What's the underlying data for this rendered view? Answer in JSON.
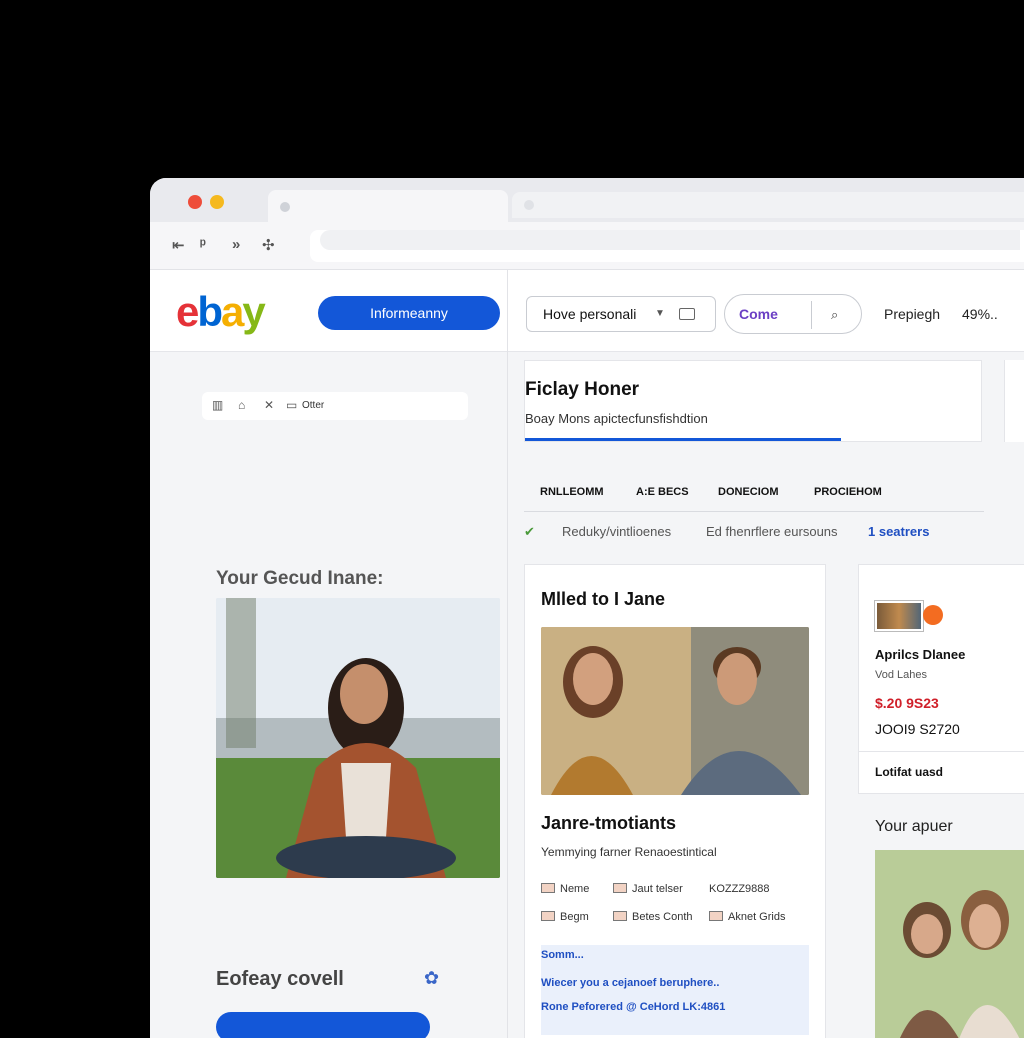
{
  "browser": {
    "nav_back": "⇤",
    "nav_p": "ᵖ",
    "nav_fwd": "»",
    "nav_ext": "✣"
  },
  "header": {
    "logo": {
      "e": "e",
      "b": "b",
      "a": "a",
      "y": "y"
    },
    "primary_button": "Informeanny",
    "select_label": "Hove personali",
    "pill_label": "Come",
    "right_text_1": "Prepiegh",
    "right_text_2": "49%.."
  },
  "left": {
    "search_text": "Otter",
    "section_title": "Your Gecud Inane:",
    "bottom_title": "Eofeay covell"
  },
  "main": {
    "panel_title": "Ficlay Honer",
    "panel_sub": "Boay Mons apictecfunsfishdtion",
    "tabs": [
      "RNLLEOMM",
      "A:E BECS",
      "DONECIOM",
      "PROCIEHOM"
    ],
    "filters": {
      "f1": "Reduky/vintlioenes",
      "f2": "Ed fhenrflere eursouns",
      "f3": "1 seatrers"
    },
    "card": {
      "title": "Mlled to I Jane",
      "name": "Janre-tmotiants",
      "desc": "Yemmying farner Renaoestintical",
      "meta": [
        "Neme",
        "Jaut telser",
        "KOZZZ9888",
        "Begm",
        "Betes Conth",
        "Aknet Grids"
      ],
      "note": [
        "Somm...",
        "Wiecer you a cejanoef beruphere..",
        "Rone Peforered @ CeHord LK:4861"
      ]
    }
  },
  "side": {
    "title": "Aprilcs Dlanee",
    "sub": "Vod Lahes",
    "price1": "$.20 9S23",
    "price2": "JOOI9 S2720",
    "link": "Lotifat uasd",
    "section_title": "Your apuer"
  }
}
